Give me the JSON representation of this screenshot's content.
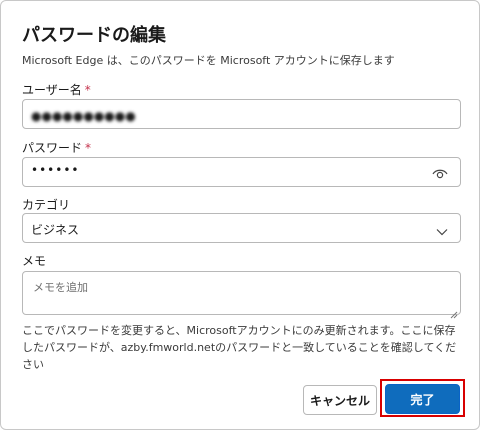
{
  "dialog": {
    "title": "パスワードの編集",
    "subtitle": "Microsoft Edge は、このパスワードを Microsoft アカウントに保存します"
  },
  "username": {
    "label": "ユーザー名",
    "required_mark": "*",
    "value": "●●●●●●●●●●"
  },
  "password": {
    "label": "パスワード",
    "required_mark": "*",
    "value": "••••••",
    "toggle_icon": "eye-icon"
  },
  "category": {
    "label": "カテゴリ",
    "selected": "ビジネス",
    "dropdown_icon": "chevron-down-icon"
  },
  "memo": {
    "label": "メモ",
    "placeholder": "メモを追加"
  },
  "note": "ここでパスワードを変更すると、Microsoftアカウントにのみ更新されます。ここに保存したパスワードが、azby.fmworld.netのパスワードと一致していることを確認してください",
  "buttons": {
    "cancel": "キャンセル",
    "done": "完了"
  },
  "colors": {
    "primary": "#0f6cbd",
    "required": "#c4314b",
    "highlight": "#d80000"
  }
}
